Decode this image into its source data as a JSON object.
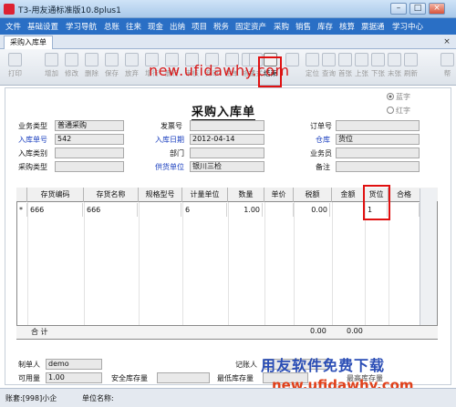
{
  "app": {
    "title": "T3-用友通标准版10.8plus1"
  },
  "menu": [
    "文件",
    "基础设置",
    "学习导航",
    "总账",
    "往来",
    "现金",
    "出纳",
    "项目",
    "税务",
    "固定资产",
    "采购",
    "销售",
    "库存",
    "核算",
    "票据通",
    "学习中心"
  ],
  "doc_tab": {
    "label": "采购入库单"
  },
  "toolbar": [
    {
      "label": "打印",
      "icon": "printer-icon"
    },
    {
      "label": "增加",
      "icon": "add-icon"
    },
    {
      "label": "修改",
      "icon": "edit-icon"
    },
    {
      "label": "删除",
      "icon": "delete-icon"
    },
    {
      "label": "保存",
      "icon": "save-icon"
    },
    {
      "label": "放弃",
      "icon": "discard-icon"
    },
    {
      "label": "增行",
      "icon": "add-row-icon"
    },
    {
      "label": "删行",
      "icon": "delete-row-icon"
    },
    {
      "label": "审核",
      "icon": "audit-icon"
    },
    {
      "label": "弃审",
      "icon": "unaudit-icon"
    },
    {
      "label": "生单",
      "icon": "generate-icon"
    },
    {
      "label": "格式",
      "icon": "format-icon"
    },
    {
      "label": "格式",
      "icon": "format2-icon"
    },
    {
      "label": "结束",
      "icon": "finish-icon",
      "active": true
    },
    {
      "label": "",
      "icon": "blank-icon"
    },
    {
      "label": "定位",
      "icon": "locate-icon"
    },
    {
      "label": "查询",
      "icon": "query-icon"
    },
    {
      "label": "首张",
      "icon": "first-icon"
    },
    {
      "label": "上张",
      "icon": "prev-icon"
    },
    {
      "label": "下张",
      "icon": "next-icon"
    },
    {
      "label": "末张",
      "icon": "last-icon"
    },
    {
      "label": "刷新",
      "icon": "refresh-icon"
    },
    {
      "label": "帮",
      "icon": "help-icon"
    }
  ],
  "watermarks": {
    "top": "new.ufidawhy.com",
    "bottom_cn": "用友软件免费下载",
    "bottom_en": "new.ufidawhy.com"
  },
  "form": {
    "title": "采购入库单",
    "radio_blue": "蓝字",
    "radio_red": "红字",
    "fields": {
      "business_type": {
        "label": "业务类型",
        "value": "普通采购"
      },
      "invoice_no": {
        "label": "发票号",
        "value": ""
      },
      "order_no": {
        "label": "订单号",
        "value": ""
      },
      "receipt_no": {
        "label": "入库单号",
        "value": "542"
      },
      "receipt_date": {
        "label": "入库日期",
        "value": "2012-04-14"
      },
      "warehouse": {
        "label": "仓库",
        "value": "货位"
      },
      "receipt_category": {
        "label": "入库类别",
        "value": ""
      },
      "department": {
        "label": "部门",
        "value": ""
      },
      "clerk": {
        "label": "业务员",
        "value": ""
      },
      "purchase_type": {
        "label": "采购类型",
        "value": ""
      },
      "supplier": {
        "label": "供货单位",
        "value": "银川三检"
      },
      "remark": {
        "label": "备注",
        "value": ""
      },
      "maker": {
        "label": "制单人",
        "value": "demo"
      },
      "bookkeeper": {
        "label": "记账人",
        "value": ""
      },
      "available_qty": {
        "label": "可用量",
        "value": "1.00"
      },
      "safety_stock": {
        "label": "安全库存量",
        "value": ""
      },
      "min_stock": {
        "label": "最低库存量",
        "value": ""
      },
      "max_stock": {
        "label": "最高库存量",
        "value": ""
      }
    }
  },
  "grid": {
    "columns": [
      "存货编码",
      "存货名称",
      "规格型号",
      "计量单位",
      "数量",
      "单价",
      "税额",
      "金额",
      "货位",
      "合格"
    ],
    "rows": [
      {
        "marker": "*",
        "code": "666",
        "name": "666",
        "spec": "",
        "unit": "6",
        "qty": "1.00",
        "price": "",
        "tax": "0.00",
        "amount": "",
        "location": "1",
        "qualified": ""
      }
    ],
    "sum": {
      "label": "合 计",
      "tax": "0.00",
      "amount": "0.00"
    }
  },
  "status": {
    "account": "账套:[998]小企",
    "unit_label": "单位名称:"
  }
}
